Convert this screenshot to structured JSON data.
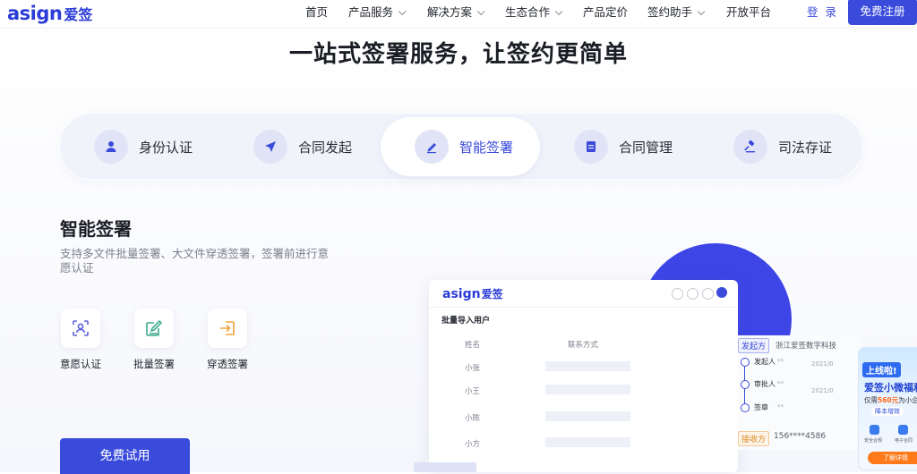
{
  "brand": {
    "logo_latin": "asign",
    "logo_cn": "爱签",
    "accent": "#3a4bdc"
  },
  "nav": {
    "items": [
      {
        "label": "首页",
        "dropdown": false
      },
      {
        "label": "产品服务",
        "dropdown": true
      },
      {
        "label": "解决方案",
        "dropdown": true
      },
      {
        "label": "生态合作",
        "dropdown": true
      },
      {
        "label": "产品定价",
        "dropdown": false
      },
      {
        "label": "签约助手",
        "dropdown": true
      },
      {
        "label": "开放平台",
        "dropdown": false
      }
    ],
    "login": "登 录",
    "register": "免费注册"
  },
  "hero": {
    "title": "一站式签署服务，让签约更简单"
  },
  "tabs": [
    {
      "label": "身份认证",
      "icon": "person-icon",
      "active": false
    },
    {
      "label": "合同发起",
      "icon": "send-arrow-icon",
      "active": false
    },
    {
      "label": "智能签署",
      "icon": "pen-icon",
      "active": true
    },
    {
      "label": "合同管理",
      "icon": "document-icon",
      "active": false
    },
    {
      "label": "司法存证",
      "icon": "gavel-icon",
      "active": false
    }
  ],
  "section": {
    "title": "智能签署",
    "description": "支持多文件批量签署、大文件穿透签署，签署前进行意愿认证",
    "features": [
      {
        "label": "意愿认证",
        "icon": "face-scan-icon"
      },
      {
        "label": "批量签署",
        "icon": "edit-icon"
      },
      {
        "label": "穿透签署",
        "icon": "enter-arrow-icon"
      }
    ],
    "cta": "免费试用"
  },
  "mockup": {
    "logo_latin": "asign",
    "logo_cn": "爱签",
    "heading": "批量导入用户",
    "columns": [
      "姓名",
      "联系方式"
    ],
    "rows": [
      "小张",
      "小王",
      "小陈",
      "小方"
    ]
  },
  "flow": {
    "sender_tag": "发起方",
    "company": "浙江爱签数字科技",
    "steps": [
      {
        "label": "发起人",
        "meta": "**",
        "date": "2021/0"
      },
      {
        "label": "审批人",
        "meta": "**",
        "date": "2021/0"
      },
      {
        "label": "签章",
        "meta": "**",
        "date": ""
      }
    ],
    "receiver_tag": "接收方",
    "phone": "156****4586"
  },
  "promo": {
    "tag": "上线啦!",
    "title": "爱签小微福利",
    "price_prefix": "仅需",
    "price": "560元",
    "price_suffix": "为小企",
    "ribbon": "降本增效",
    "captions": [
      "安全合规",
      "电子合同"
    ],
    "button": "了解详情"
  }
}
